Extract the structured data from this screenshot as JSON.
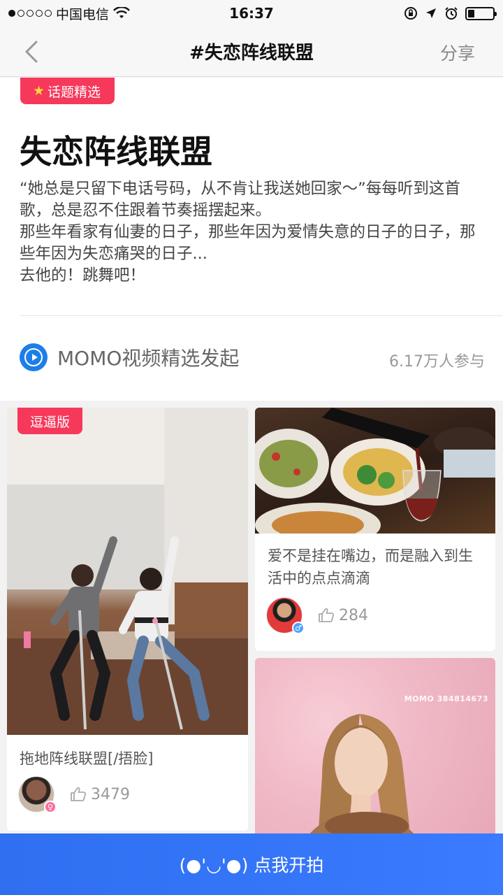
{
  "status_bar": {
    "carrier": "中国电信",
    "time": "16:37",
    "signal_dots_filled": 1,
    "signal_dots_total": 5,
    "battery_level": 0.25
  },
  "nav": {
    "back_icon": "chevron-left-icon",
    "title": "#失恋阵线联盟",
    "share_label": "分享"
  },
  "topic": {
    "featured_tag": "话题精选",
    "title": "失恋阵线联盟",
    "description": "“她总是只留下电话号码，从不肯让我送她回家～”每每听到这首歌，总是忍不住跟着节奏摇摆起来。\n那些年看家有仙妻的日子，那些年因为爱情失意的日子的日子，那些年因为失恋痛哭的日子...\n去他的！跳舞吧！",
    "starter": "MOMO视频精选发起",
    "participants": "6.17万人参与"
  },
  "posts": [
    {
      "badge": "逗逼版",
      "caption": "拖地阵线联盟[/捂脸]",
      "likes": "3479",
      "gender": "female"
    },
    {
      "caption": "爱不是挂在嘴边，而是融入到生活中的点点滴滴",
      "likes": "284",
      "gender": "male"
    },
    {
      "watermark": "MOMO 384814673"
    }
  ],
  "cta": {
    "label": "(●'◡'●) 点我开拍"
  },
  "colors": {
    "accent_red": "#f6385b",
    "accent_blue": "#3a7bff",
    "starter_blue": "#1e7ee8"
  }
}
